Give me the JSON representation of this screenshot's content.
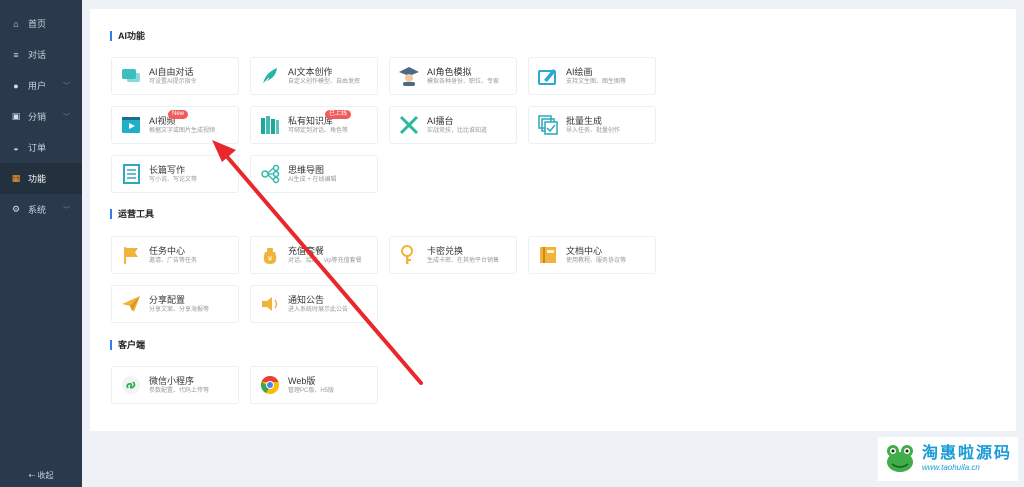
{
  "sidebar": {
    "items": [
      {
        "label": "首页",
        "icon": "home-icon",
        "glyph": "⌂",
        "chevron": false,
        "active": false
      },
      {
        "label": "对话",
        "icon": "menu-icon",
        "glyph": "≡",
        "chevron": false,
        "active": false
      },
      {
        "label": "用户",
        "icon": "user-icon",
        "glyph": "●",
        "chevron": true,
        "active": false
      },
      {
        "label": "分销",
        "icon": "share-icon",
        "glyph": "▣",
        "chevron": true,
        "active": false
      },
      {
        "label": "订单",
        "icon": "order-icon",
        "glyph": "◒",
        "chevron": false,
        "active": false
      },
      {
        "label": "功能",
        "icon": "grid-icon",
        "glyph": "▦",
        "chevron": false,
        "active": true
      },
      {
        "label": "系统",
        "icon": "gear-icon",
        "glyph": "⚙",
        "chevron": true,
        "active": false
      }
    ],
    "collapse_label": "⇠ 收起",
    "active_color": "#ff9f2a"
  },
  "sections": [
    {
      "title": "AI功能",
      "cards": [
        {
          "title": "AI自由对话",
          "desc": "可设置AI提示指令",
          "icon": "chat-bubble-icon",
          "color": "#3bbfbf"
        },
        {
          "title": "AI文本创作",
          "desc": "自定义创作模型、自由发挥",
          "icon": "feather-icon",
          "color": "#26b5a3"
        },
        {
          "title": "AI角色模拟",
          "desc": "模拟各种身份、职位、专家",
          "icon": "graduate-icon",
          "color": "#4a6a86"
        },
        {
          "title": "AI绘画",
          "desc": "支持文生图、图生图等",
          "icon": "paint-icon",
          "color": "#2ea6d6"
        },
        {
          "title": "AI视频",
          "desc": "根据文字或图片生成视频",
          "icon": "video-icon",
          "color": "#1fb0c9",
          "badge": "New"
        },
        {
          "title": "私有知识库",
          "desc": "可绑定到对话、角色等",
          "icon": "books-icon",
          "color": "#18a99b",
          "badge": "已上线"
        },
        {
          "title": "AI擂台",
          "desc": "实战竞技，比比谁知道",
          "icon": "swords-icon",
          "color": "#2eb8a0"
        },
        {
          "title": "批量生成",
          "desc": "导入任务、批量创作",
          "icon": "batch-icon",
          "color": "#2aa8b8"
        },
        {
          "title": "长篇写作",
          "desc": "写小说、写论文等",
          "icon": "document-icon",
          "color": "#2ea8c0"
        },
        {
          "title": "思维导图",
          "desc": "AI生成 + 在线编辑",
          "icon": "mindmap-icon",
          "color": "#2eb8a8"
        }
      ]
    },
    {
      "title": "运营工具",
      "cards": [
        {
          "title": "任务中心",
          "desc": "邀请、广告等任务",
          "icon": "flag-icon",
          "color": "#f0b43a"
        },
        {
          "title": "充值套餐",
          "desc": "对话、绘画、vip等充值套餐",
          "icon": "money-bag-icon",
          "color": "#f0b43a"
        },
        {
          "title": "卡密兑换",
          "desc": "生成卡密、在其他平台销售",
          "icon": "key-icon",
          "color": "#f0b43a"
        },
        {
          "title": "文档中心",
          "desc": "使用教程、服务协议等",
          "icon": "book-icon",
          "color": "#f0b43a"
        },
        {
          "title": "分享配置",
          "desc": "分享文案、分享海报等",
          "icon": "paper-plane-icon",
          "color": "#f0b43a"
        },
        {
          "title": "通知公告",
          "desc": "进入系统时展示此公告",
          "icon": "speaker-icon",
          "color": "#f0b43a"
        }
      ]
    },
    {
      "title": "客户端",
      "cards": [
        {
          "title": "微信小程序",
          "desc": "参数配置、代码上传等",
          "icon": "miniprogram-icon",
          "color": "#2bb24c"
        },
        {
          "title": "Web版",
          "desc": "管理PC版、H5版",
          "icon": "chrome-icon",
          "color": "#e94235"
        }
      ]
    }
  ],
  "watermark": {
    "line1": "淘惠啦源码",
    "line2": "www.taohuila.cn",
    "color": "#1a9bd7"
  },
  "annotation_color": "#e8282b"
}
